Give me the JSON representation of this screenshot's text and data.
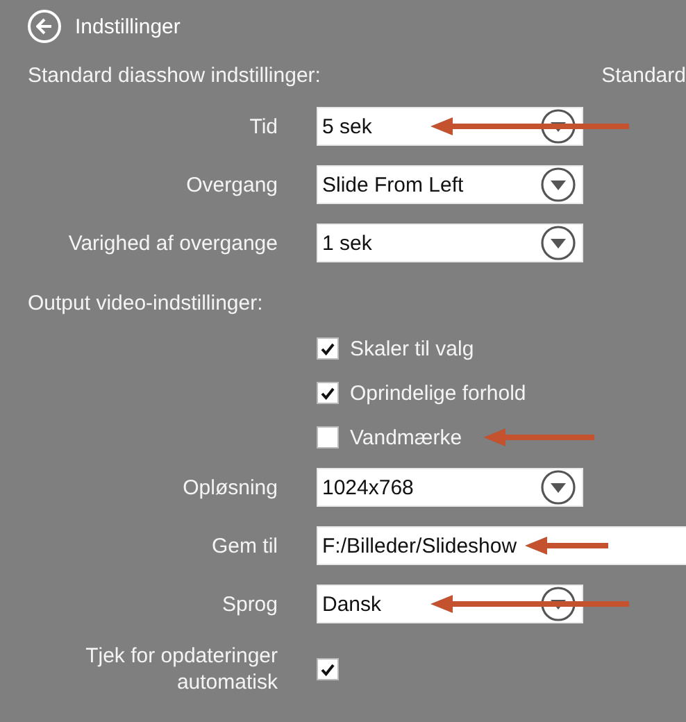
{
  "header": {
    "title": "Indstillinger"
  },
  "side_heading": "Standard",
  "sections": [
    {
      "title": "Standard diasshow indstillinger:",
      "items": [
        {
          "kind": "select",
          "label": "Tid",
          "value": "5 sek",
          "arrow": true
        },
        {
          "kind": "select",
          "label": "Overgang",
          "value": "Slide From Left",
          "arrow": false
        },
        {
          "kind": "select",
          "label": "Varighed af overgange",
          "value": "1 sek",
          "arrow": false
        }
      ]
    },
    {
      "title": "Output video-indstillinger:",
      "items": [
        {
          "kind": "checkbox",
          "label": "Skaler til valg",
          "checked": true,
          "arrow": false
        },
        {
          "kind": "checkbox",
          "label": "Oprindelige forhold",
          "checked": true,
          "arrow": false
        },
        {
          "kind": "checkbox",
          "label": "Vandmærke",
          "checked": false,
          "arrow": true
        },
        {
          "kind": "select",
          "label": "Opløsning",
          "value": "1024x768",
          "arrow": false
        },
        {
          "kind": "text",
          "label": "Gem til",
          "value": "F:/Billeder/Slideshow",
          "arrow": true
        },
        {
          "kind": "select",
          "label": "Sprog",
          "value": "Dansk",
          "arrow": true
        },
        {
          "kind": "labeled_checkbox",
          "label": "Tjek for opdateringer automatisk",
          "checked": true
        }
      ]
    }
  ]
}
